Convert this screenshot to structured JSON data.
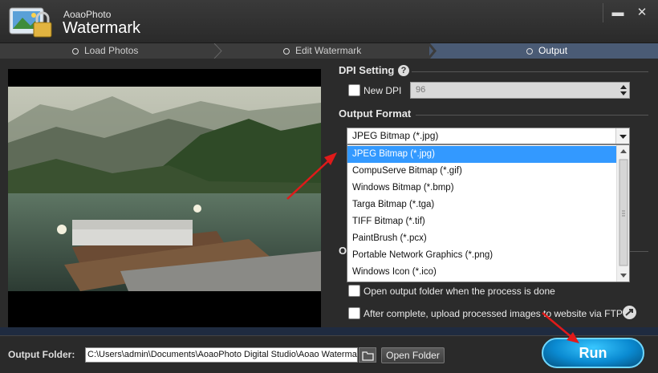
{
  "app": {
    "subtitle": "AoaoPhoto",
    "title": "Watermark",
    "minimize_icon": "minimize-icon",
    "close_icon": "close-icon"
  },
  "steps": [
    {
      "label": "Load Photos",
      "active": false
    },
    {
      "label": "Edit Watermark",
      "active": false
    },
    {
      "label": "Output",
      "active": true
    }
  ],
  "dpi_setting": {
    "title": "DPI Setting",
    "checkbox_label": "New DPI",
    "checked": false,
    "value": "96"
  },
  "output_format": {
    "title": "Output Format",
    "selected": "JPEG Bitmap (*.jpg)",
    "options": [
      "JPEG Bitmap (*.jpg)",
      "CompuServe Bitmap (*.gif)",
      "Windows Bitmap (*.bmp)",
      "Targa Bitmap (*.tga)",
      "TIFF Bitmap (*.tif)",
      "PaintBrush (*.pcx)",
      "Portable Network Graphics (*.png)",
      "Windows Icon (*.ico)"
    ]
  },
  "options": {
    "title": "O",
    "open_folder_label": "Open output folder when the process is done",
    "ftp_label": "After complete, upload processed images to website via FTP"
  },
  "bottom": {
    "output_folder_label": "Output Folder:",
    "output_folder_path": "C:\\Users\\admin\\Documents\\AoaoPhoto Digital Studio\\Aoao Watermark",
    "open_folder_button": "Open Folder",
    "run_button": "Run"
  },
  "colors": {
    "accent": "#3399ff",
    "active_step": "#4a5b75",
    "annotation_arrow": "#e01a1a"
  }
}
